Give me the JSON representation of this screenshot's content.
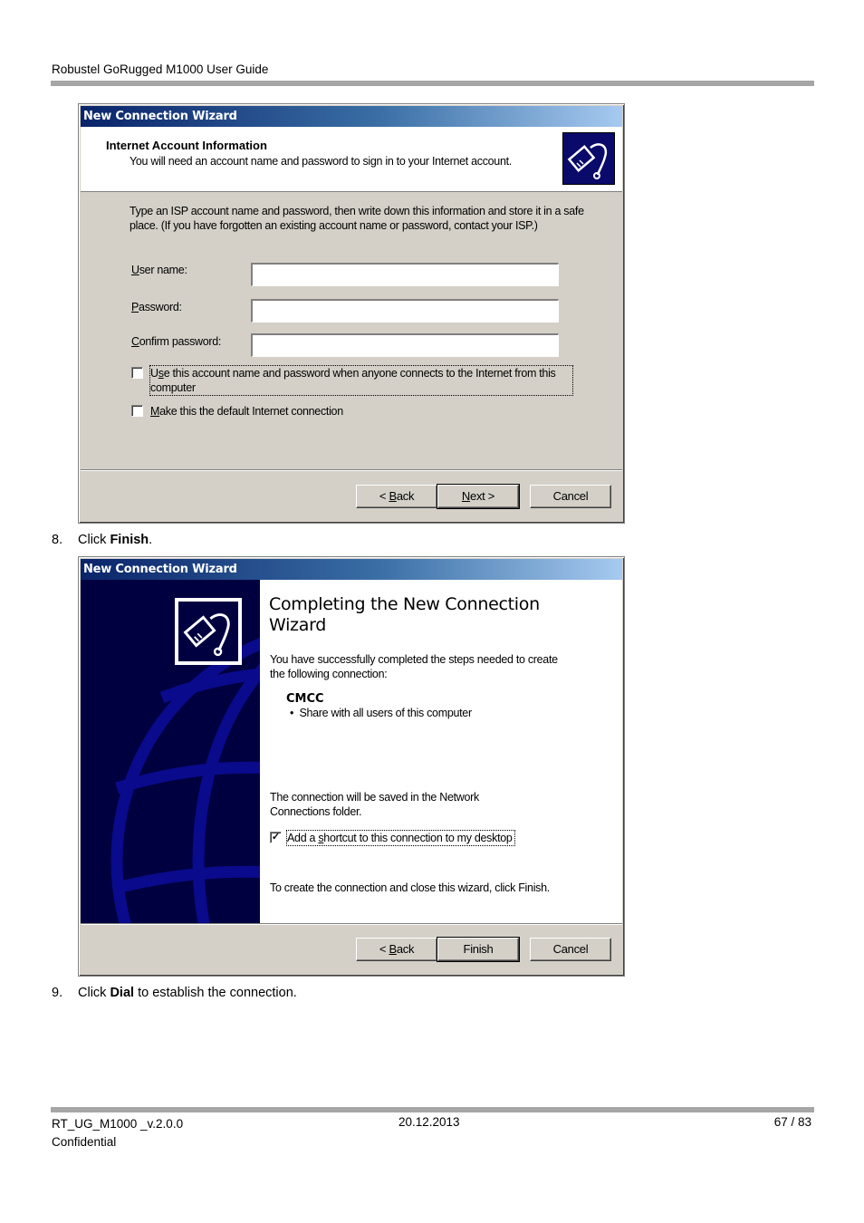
{
  "document": {
    "header_title": "Robustel GoRugged M1000 User Guide",
    "footer": {
      "doc_id": "RT_UG_M1000 _v.2.0.0",
      "classification": "Confidential",
      "date": "20.12.2013",
      "page": "67 / 83"
    },
    "steps": [
      {
        "number": "8.",
        "prefix": "Click ",
        "bold": "Finish",
        "suffix": "."
      },
      {
        "number": "9.",
        "prefix": "Click ",
        "bold": "Dial",
        "suffix": " to establish the connection."
      }
    ]
  },
  "dialog_account": {
    "title": "New Connection Wizard",
    "header_title": "Internet Account Information",
    "header_subtitle": "You will need an account name and password to sign in to your Internet account.",
    "icon": "network-cable-icon",
    "intro": "Type an ISP account name and password, then write down this information and store it in a safe place. (If you have forgotten an existing account name or password, contact your ISP.)",
    "fields": {
      "user_name": {
        "label_access": "U",
        "label_rest": "ser name:",
        "value": ""
      },
      "password": {
        "label_access": "P",
        "label_rest": "assword:",
        "value": ""
      },
      "confirm_password": {
        "label_access": "C",
        "label_rest": "onfirm password:",
        "value": ""
      }
    },
    "checkboxes": {
      "use_for_all": {
        "label_pre": "U",
        "label_access": "s",
        "label_rest": "e this account  name and password when anyone connects to the Internet from this computer",
        "checked": false
      },
      "default_connection": {
        "label_access": "M",
        "label_rest": "ake this the default Internet connection",
        "checked": false
      }
    },
    "buttons": {
      "back_pre": "< ",
      "back_access": "B",
      "back_rest": "ack",
      "next_access": "N",
      "next_rest": "ext >",
      "cancel": "Cancel"
    }
  },
  "dialog_complete": {
    "title": "New Connection Wizard",
    "heading": "Completing the New Connection Wizard",
    "intro": "You have successfully completed the steps needed to create the following connection:",
    "connection_name": "CMCC",
    "connection_detail": "Share with all users of this computer",
    "saved_note": "The connection will be saved in the Network Connections folder.",
    "shortcut_checkbox": {
      "label_pre": "Add a ",
      "label_access": "s",
      "label_rest": "hortcut to this connection to my desktop",
      "checked": true
    },
    "finish_note": "To create the connection and close this wizard, click Finish.",
    "buttons": {
      "back_pre": "< ",
      "back_access": "B",
      "back_rest": "ack",
      "finish": "Finish",
      "cancel": "Cancel"
    }
  }
}
